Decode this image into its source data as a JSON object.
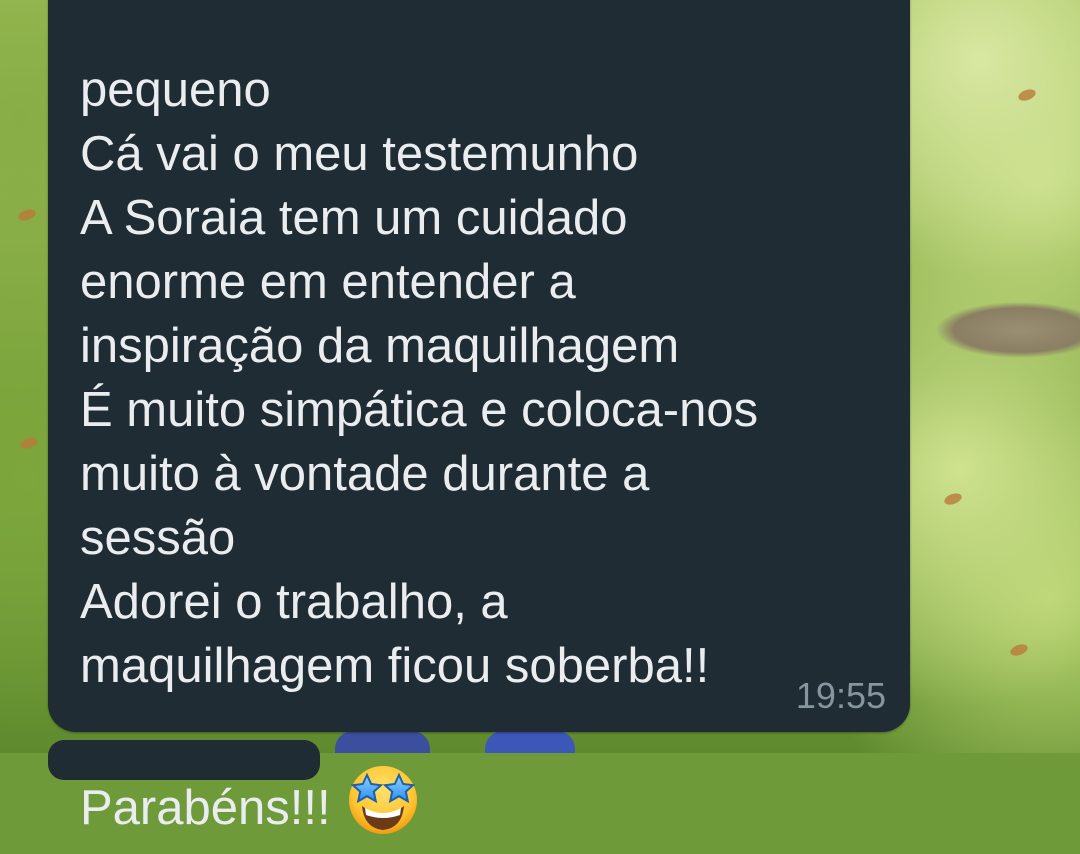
{
  "chat": {
    "message": {
      "text": "pequeno\nCá vai o meu testemunho\nA Soraia tem um cuidado\nenorme em entender a\ninspiração da maquilhagem\nÉ muito simpática e coloca-nos\nmuito à vontade durante a\nsessão\nAdorei o trabalho, a\nmaquilhagem ficou soberba!!\nParabéns!!!",
      "emoji": "star-struck-icon",
      "time": "19:55"
    }
  },
  "colors": {
    "bubble": "#202c33",
    "text": "#e9edef",
    "timestamp": "#8696a0"
  }
}
